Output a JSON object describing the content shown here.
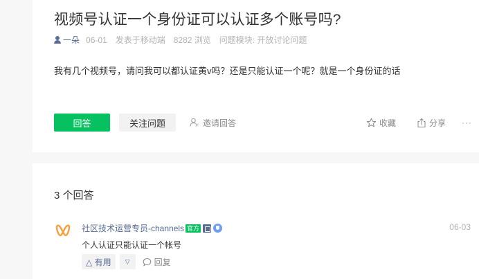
{
  "question": {
    "title": "视频号认证一个身份证可以认证多个账号吗?",
    "author": "一朵",
    "date": "06-01",
    "source": "发表于移动端",
    "views": "8282 浏览",
    "module": "问题模块: 开放讨论问题",
    "body": "我有几个视频号，请问我可以都认证黄v吗？还是只能认证一个呢？就是一个身份证的话"
  },
  "actions": {
    "answer": "回答",
    "follow": "关注问题",
    "invite": "邀请回答",
    "favorite": "收藏",
    "share": "分享",
    "more": "···"
  },
  "answers": {
    "count_label": "3 个回答",
    "items": [
      {
        "author": "社区技术运营专员-channels",
        "official_badge": "官方",
        "date": "06-03",
        "text": "个人认证只能认证一个帐号",
        "useful": "△ 有用",
        "useless": "▽",
        "reply": "回复"
      }
    ]
  },
  "colors": {
    "primary": "#07c160",
    "link": "#576b95",
    "muted": "#b2b2b2"
  }
}
